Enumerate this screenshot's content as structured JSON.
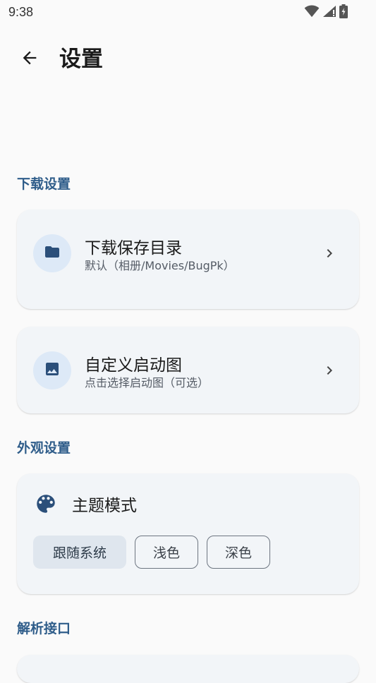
{
  "status_bar": {
    "time": "9:38"
  },
  "app_bar": {
    "title": "设置"
  },
  "sections": {
    "download": {
      "header": "下载设置",
      "items": [
        {
          "title": "下载保存目录",
          "subtitle": "默认（相册/Movies/BugPk）",
          "icon": "folder-icon"
        },
        {
          "title": "自定义启动图",
          "subtitle": "点击选择启动图（可选）",
          "icon": "image-icon"
        }
      ]
    },
    "appearance": {
      "header": "外观设置",
      "theme_title": "主题模式",
      "theme_icon": "palette-icon",
      "options": [
        "跟随系统",
        "浅色",
        "深色"
      ],
      "selected": "跟随系统"
    },
    "api": {
      "header": "解析接口"
    }
  },
  "colors": {
    "accent": "#2f5d8a",
    "card": "#f2f5f8",
    "icon_bg": "#dde9f7",
    "icon_fg": "#2b4f7a",
    "chip_selected": "#dfe6ee"
  }
}
